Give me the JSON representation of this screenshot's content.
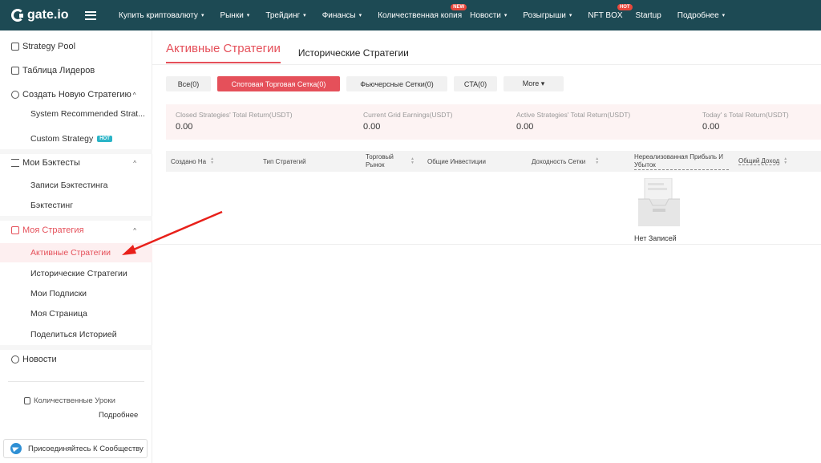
{
  "topnav": {
    "logo_text": "gate.io",
    "items": [
      {
        "label": "Купить криптовалюту",
        "caret": "▾"
      },
      {
        "label": "Рынки",
        "caret": "▾"
      },
      {
        "label": "Трейдинг",
        "caret": "▾"
      },
      {
        "label": "Финансы",
        "caret": "▾"
      },
      {
        "label": "Количественная копия",
        "badge": "NEW"
      },
      {
        "label": "Новости",
        "caret": "▾"
      },
      {
        "label": "Розыгрыши",
        "caret": "▾"
      },
      {
        "label": "NFT BOX",
        "badge": "HOT"
      },
      {
        "label": "Startup"
      },
      {
        "label": "Подробнее",
        "caret": "▾"
      }
    ]
  },
  "sidebar": {
    "strategy_pool": "Strategy Pool",
    "leaderboard": "Таблица Лидеров",
    "create_new": "Создать Новую Стратегию",
    "system_recommended": "System Recommended Strat...",
    "custom_strategy": "Custom Strategy",
    "custom_badge": "HOT",
    "backtests": "Мои Бэктесты",
    "backtest_records": "Записи Бэктестинга",
    "backtesting": "Бэктестинг",
    "my_strategy": "Моя Стратегия",
    "active_strategies": "Активные Стратегии",
    "historical_strategies": "Исторические Стратегии",
    "my_subscriptions": "Мои Подписки",
    "my_page": "Моя Страница",
    "share_history": "Поделиться Историей",
    "news": "Новости",
    "quant_lessons": "Количественные Уроки",
    "more": "Подробнее",
    "join_community": "Присоединяйтесь К Сообществу"
  },
  "main": {
    "tab_active": "Активные Стратегии",
    "tab_history": "Исторические Стратегии",
    "filters": [
      {
        "label": "Все(0)",
        "active": false
      },
      {
        "label": "Спотовая Торговая Сетка(0)",
        "active": true
      },
      {
        "label": "Фьючерсные Сетки(0)",
        "active": false
      },
      {
        "label": "CTA(0)",
        "active": false
      },
      {
        "label": "More ▾",
        "active": false
      }
    ],
    "stats": [
      {
        "label": "Closed Strategies'   Total Return(USDT)",
        "value": "0.00"
      },
      {
        "label": "Current Grid Earnings(USDT)",
        "value": "0.00"
      },
      {
        "label": "Active Strategies'   Total Return(USDT)",
        "value": "0.00"
      },
      {
        "label": "Today'   s Total Return(USDT)",
        "value": "0.00"
      }
    ],
    "columns": {
      "created": "Создано На",
      "type": "Тип Стратегий",
      "market": "Торговый Рынок",
      "investment": "Общие Инвестиции",
      "grid_yield": "Доходность Сетки",
      "unrealized": "Нереализованная Прибыль И Убыток",
      "total_income": "Общий Доход"
    },
    "empty_text": "Нет Записей"
  },
  "colors": {
    "nav_bg": "#1d4a54",
    "accent": "#e5505a",
    "arrow": "#e8201a"
  }
}
